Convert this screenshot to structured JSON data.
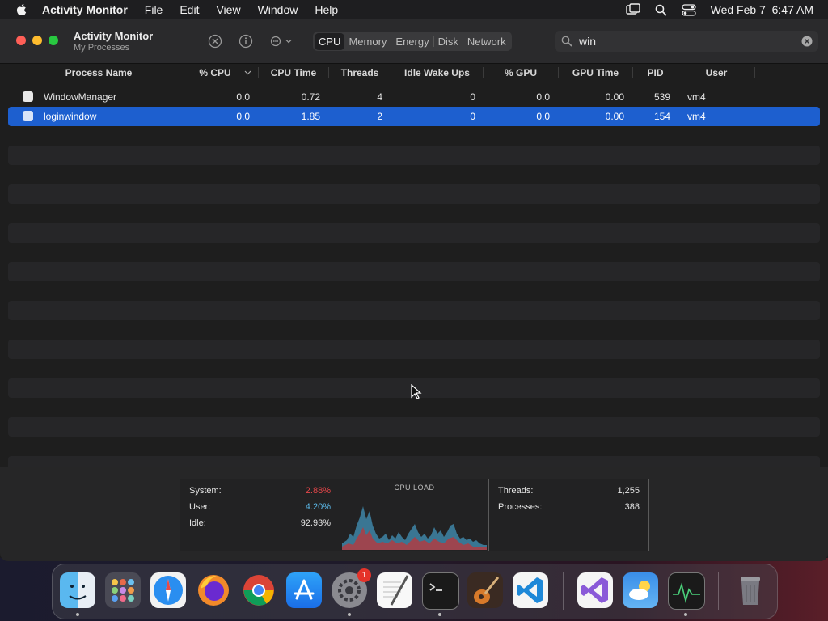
{
  "menubar": {
    "app_name": "Activity Monitor",
    "items": [
      "File",
      "Edit",
      "View",
      "Window",
      "Help"
    ],
    "datetime": "Wed Feb 7  6:47 AM"
  },
  "window": {
    "title": "Activity Monitor",
    "subtitle": "My Processes",
    "tabs": [
      {
        "label": "CPU",
        "active": true
      },
      {
        "label": "Memory",
        "active": false
      },
      {
        "label": "Energy",
        "active": false
      },
      {
        "label": "Disk",
        "active": false
      },
      {
        "label": "Network",
        "active": false
      }
    ],
    "search": {
      "value": "win"
    }
  },
  "table": {
    "columns": [
      "Process Name",
      "% CPU",
      "CPU Time",
      "Threads",
      "Idle Wake Ups",
      "% GPU",
      "GPU Time",
      "PID",
      "User"
    ],
    "rows": [
      {
        "name": "WindowManager",
        "cpu": "0.0",
        "cpu_time": "0.72",
        "threads": "4",
        "idle_wake_ups": "0",
        "gpu": "0.0",
        "gpu_time": "0.00",
        "pid": "539",
        "user": "vm4",
        "selected": false
      },
      {
        "name": "loginwindow",
        "cpu": "0.0",
        "cpu_time": "1.85",
        "threads": "2",
        "idle_wake_ups": "0",
        "gpu": "0.0",
        "gpu_time": "0.00",
        "pid": "154",
        "user": "vm4",
        "selected": true
      }
    ]
  },
  "stats": {
    "system_label": "System:",
    "system_value": "2.88%",
    "user_label": "User:",
    "user_value": "4.20%",
    "idle_label": "Idle:",
    "idle_value": "92.93%",
    "cpu_load_title": "CPU LOAD",
    "threads_label": "Threads:",
    "threads_value": "1,255",
    "processes_label": "Processes:",
    "processes_value": "388"
  },
  "colors": {
    "system": "#e8474a",
    "user": "#5bb8e8",
    "selection": "#1d5fcf",
    "accent_red_light": "#ff5f57",
    "accent_yellow_light": "#febc2e",
    "accent_green_light": "#28c840"
  },
  "dock": {
    "apps": [
      "finder-icon",
      "launchpad-icon",
      "safari-icon",
      "firefox-icon",
      "chrome-icon",
      "app-store-icon",
      "system-settings-icon",
      "textedit-icon",
      "terminal-icon",
      "garageband-icon",
      "vscode-icon",
      "visual-studio-icon",
      "weather-icon",
      "activity-monitor-icon",
      "trash-icon"
    ],
    "settings_badge": "1"
  }
}
